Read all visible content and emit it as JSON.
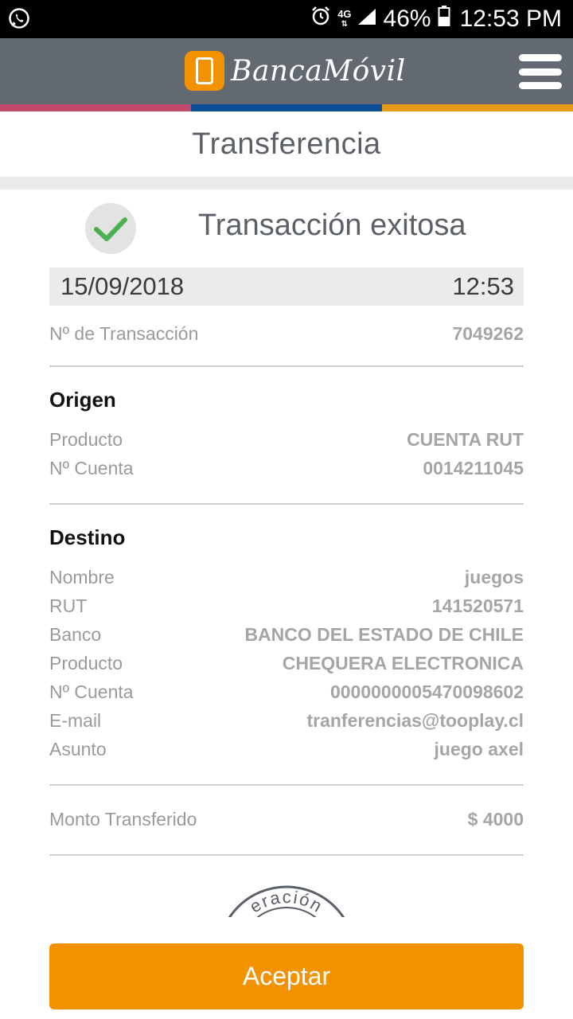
{
  "status_bar": {
    "network": "4G",
    "battery": "46%",
    "time": "12:53 PM"
  },
  "header": {
    "app_name": "BancaMóvil"
  },
  "stripe_colors": [
    "#c2496a",
    "#0d4f96",
    "#e79a17"
  ],
  "page": {
    "title": "Transferencia"
  },
  "result": {
    "status": "Transacción exitosa",
    "date": "15/09/2018",
    "time": "12:53",
    "transaction_label": "Nº de Transacción",
    "transaction_number": "7049262"
  },
  "origin": {
    "heading": "Origen",
    "rows": [
      {
        "label": "Producto",
        "value": "CUENTA RUT"
      },
      {
        "label": "Nº Cuenta",
        "value": "0014211045"
      }
    ]
  },
  "destination": {
    "heading": "Destino",
    "rows": [
      {
        "label": "Nombre",
        "value": "juegos"
      },
      {
        "label": "RUT",
        "value": "141520571"
      },
      {
        "label": "Banco",
        "value": "BANCO DEL ESTADO DE CHILE"
      },
      {
        "label": "Producto",
        "value": "CHEQUERA ELECTRONICA"
      },
      {
        "label": "Nº Cuenta",
        "value": "0000000005470098602"
      },
      {
        "label": "E-mail",
        "value": "tranferencias@tooplay.cl"
      },
      {
        "label": "Asunto",
        "value": "juego axel"
      }
    ]
  },
  "amount": {
    "label": "Monto Transferido",
    "value": "$ 4000"
  },
  "stamp": {
    "text": "eración"
  },
  "actions": {
    "accept_label": "Aceptar"
  },
  "colors": {
    "header_bg": "#626970",
    "accent": "#f39200",
    "check": "#4caf50"
  }
}
